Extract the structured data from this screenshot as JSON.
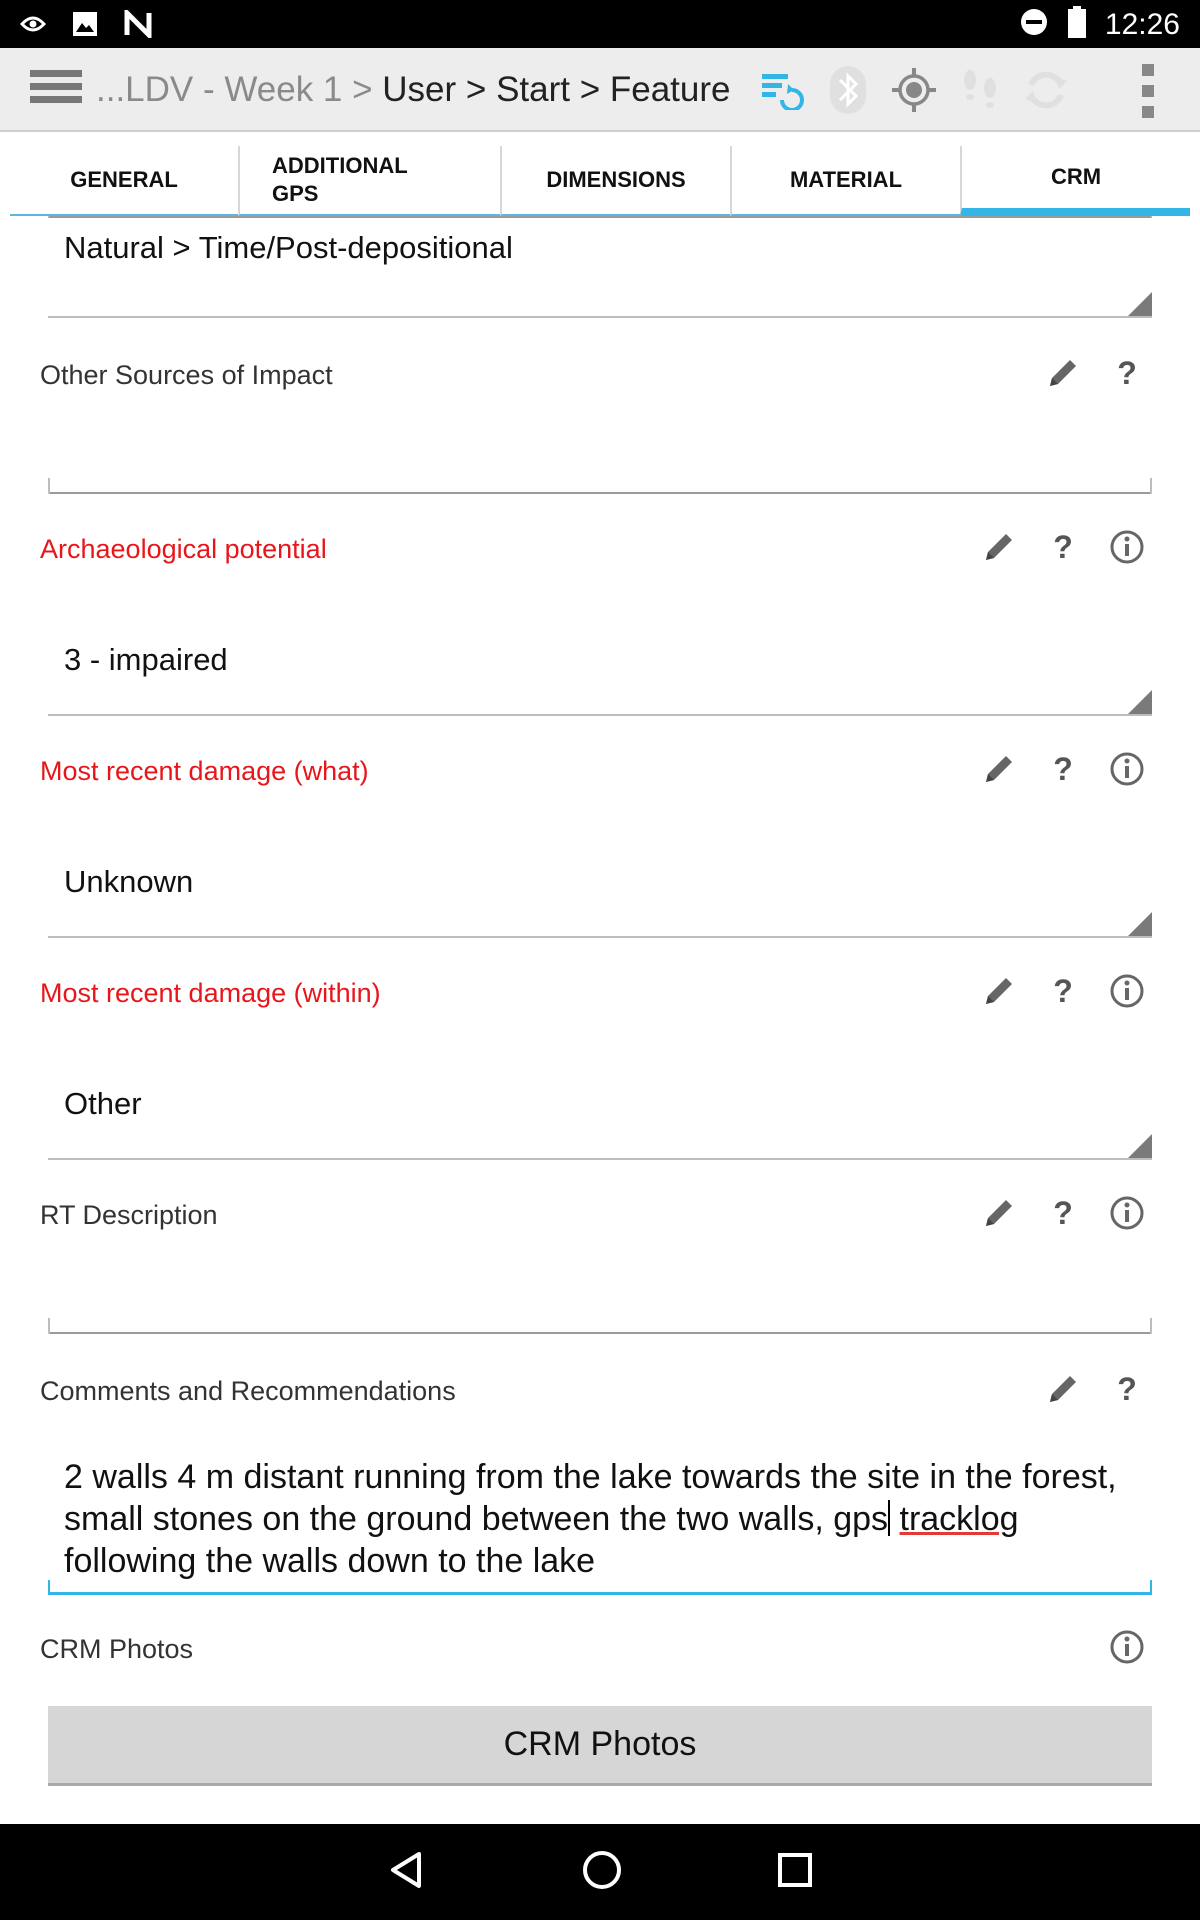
{
  "status_bar": {
    "time": "12:26",
    "icons": [
      "nvidia-icon",
      "image-icon",
      "notification-n-icon",
      "do-not-disturb-icon",
      "battery-icon"
    ]
  },
  "toolbar": {
    "breadcrumb_muted": "...LDV - Week 1 > ",
    "breadcrumb_main": "User > Start > Feature",
    "icons": [
      "sync-icon",
      "bluetooth-icon",
      "gps-icon",
      "tracklog-icon",
      "refresh-icon",
      "overflow-menu-icon"
    ]
  },
  "tabs": [
    {
      "line1": "GENERAL",
      "line2": ""
    },
    {
      "line1": "ADDITIONAL",
      "line2": "GPS"
    },
    {
      "line1": "DIMENSIONS",
      "line2": ""
    },
    {
      "line1": "MATERIAL",
      "line2": ""
    },
    {
      "line1": "CRM",
      "line2": ""
    }
  ],
  "active_tab": "CRM",
  "fields": {
    "impact_value": "Natural > Time/Post-depositional",
    "other_sources": {
      "label": "Other Sources of Impact",
      "value": ""
    },
    "arch_potential": {
      "label": "Archaeological potential",
      "value": "3 - impaired"
    },
    "damage_what": {
      "label": "Most recent damage (what)",
      "value": "Unknown"
    },
    "damage_within": {
      "label": "Most recent damage (within)",
      "value": "Other"
    },
    "rt_description": {
      "label": "RT Description",
      "value": ""
    },
    "comments": {
      "label": "Comments and Recommendations",
      "value_part1": "2 walls 4 m distant running from the lake towards the site in the forest, small stones on the ground between the two walls, gps",
      "value_misspelled": "tracklog",
      "value_part2": " following the walls down to the lake"
    },
    "crm_photos": {
      "label": "CRM Photos",
      "button": "CRM Photos"
    }
  },
  "colors": {
    "required_label": "#e8161b",
    "accent": "#33b5e5"
  },
  "nav_bar": {
    "icons": [
      "back-icon",
      "home-icon",
      "recents-icon"
    ]
  }
}
